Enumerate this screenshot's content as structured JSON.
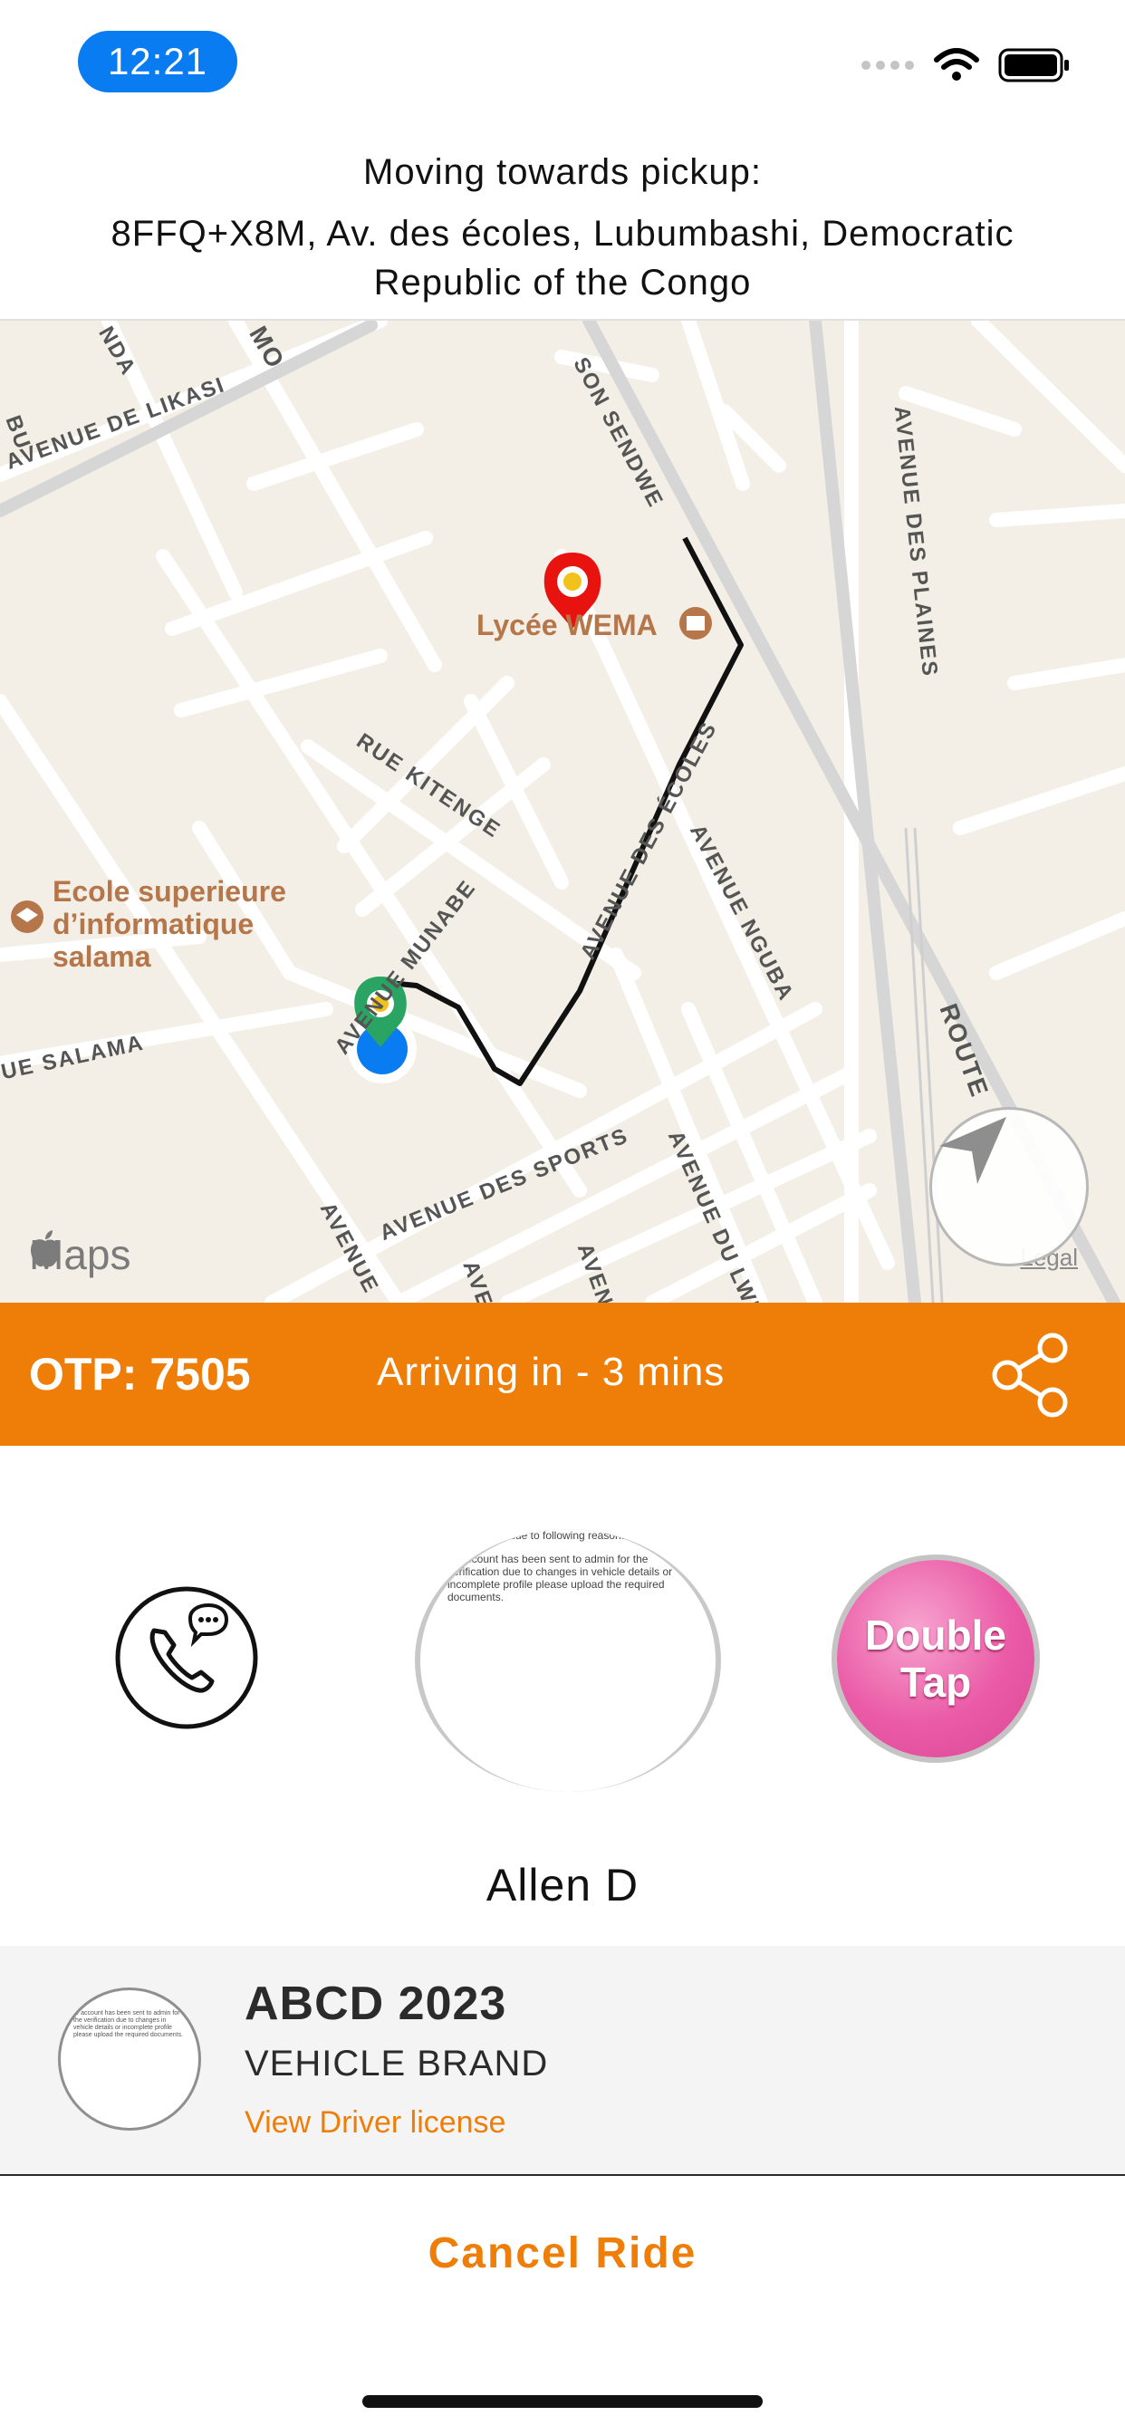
{
  "status_bar": {
    "time": "12:21"
  },
  "header": {
    "title": "Moving towards pickup:",
    "address": "8FFQ+X8M, Av. des écoles, Lubumbashi, Democratic Republic of the Congo"
  },
  "map": {
    "street_labels": [
      "AVENUE DE LIKASI",
      "SON SENDWE",
      "AVENUE DES PLAINES",
      "RUE KITENGE",
      "AVENUE DES ÉCOLES",
      "AVENUE NGUBA",
      "AVENUE MUNABE",
      "UE SALAMA",
      "AVENUE DES SPORTS",
      "AVENUE DU LWI",
      "ROUTE",
      "AVENUE",
      "AVE",
      "AVEN",
      "NDA",
      "MO",
      "BU"
    ],
    "poi_school_1": "Lycée WEMA",
    "poi_school_2": "Ecole superieure d’informatique salama",
    "maps_brand": "Maps",
    "legal": "Legal"
  },
  "ride_bar": {
    "otp": "OTP: 7505",
    "eta": "Arriving in - 3 mins"
  },
  "driver": {
    "photo_caption": "due to following reasons",
    "photo_text": "ur account has been sent to admin for the verification due to changes in vehicle details or incomplete profile please upload the required documents.",
    "double_tap_line1": "Double",
    "double_tap_line2": "Tap",
    "name": "Allen D"
  },
  "vehicle": {
    "plate": "ABCD 2023",
    "brand": "VEHICLE BRAND",
    "license_link": "View Driver license"
  },
  "actions": {
    "cancel": "Cancel Ride"
  },
  "colors": {
    "accent": "#ee7e07",
    "blue": "#0a7cf2",
    "map_bg": "#f3efe6"
  },
  "icons": [
    "wifi-icon",
    "battery-icon",
    "signal-icon",
    "pin-red-icon",
    "pin-green-icon",
    "school-icon",
    "apple-icon",
    "location-arrow-icon",
    "share-icon",
    "phone-chat-icon"
  ]
}
